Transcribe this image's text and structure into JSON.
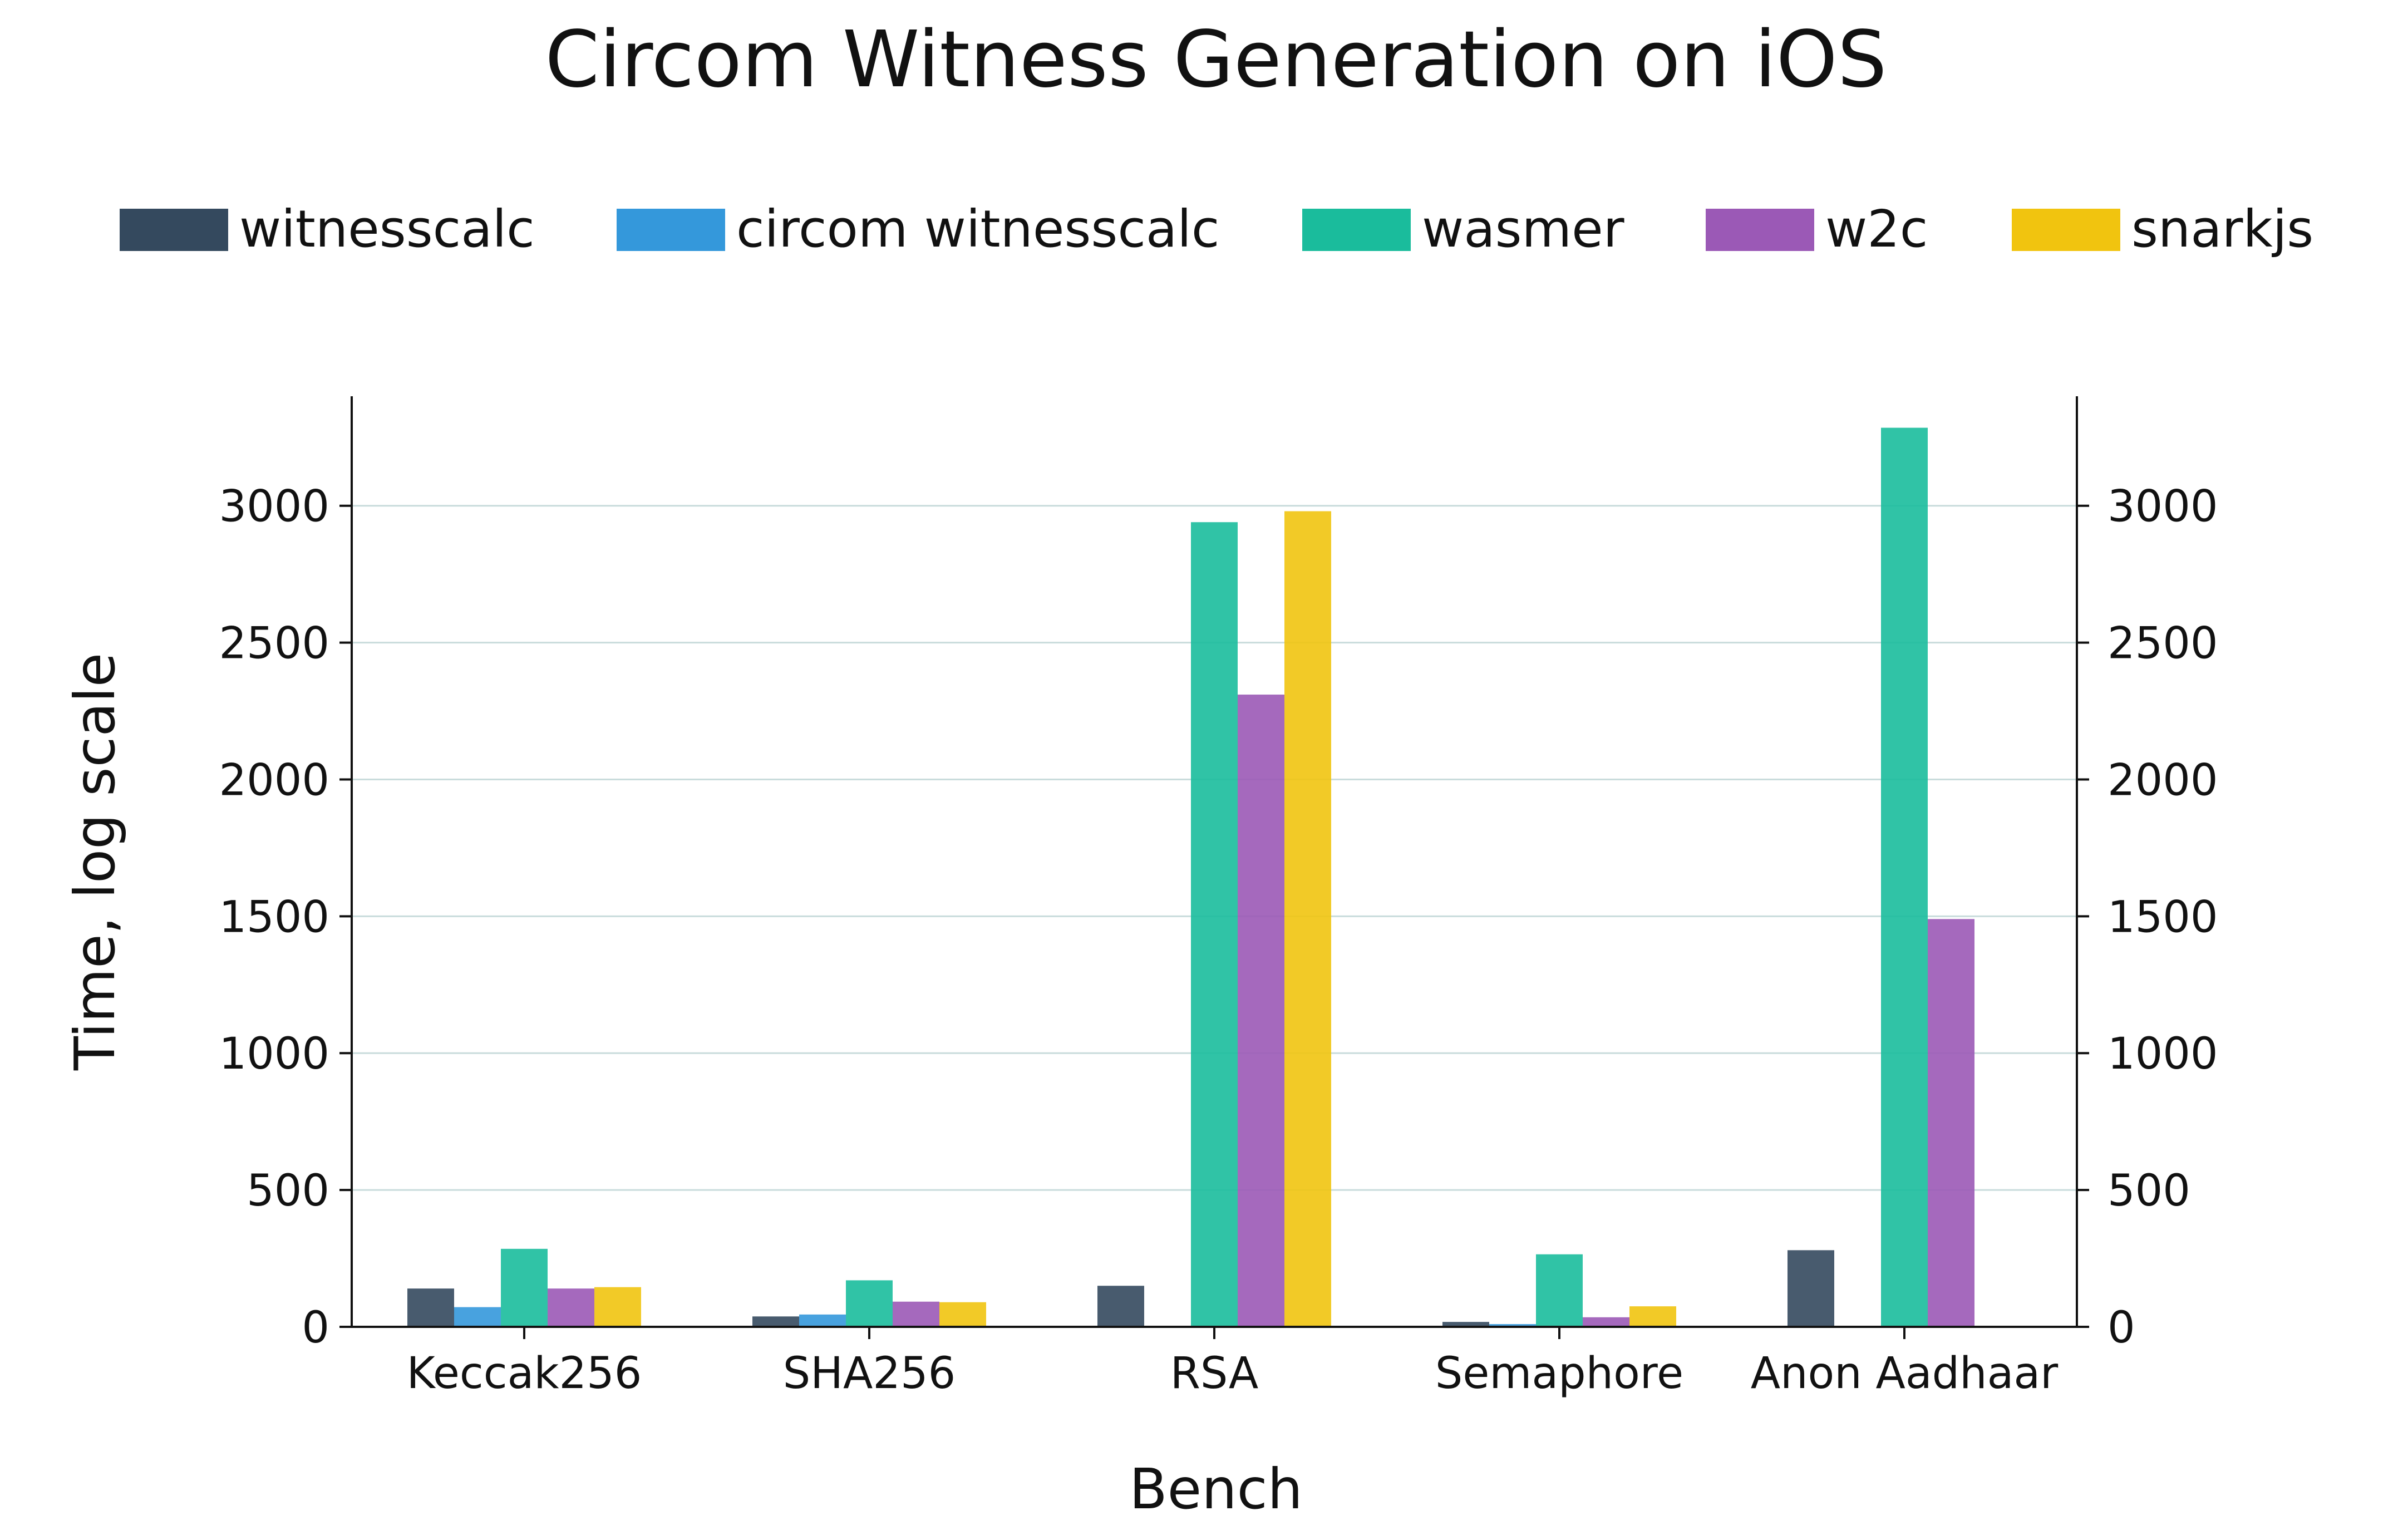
{
  "chart_data": {
    "type": "bar",
    "title": "Circom Witness Generation on iOS",
    "xlabel": "Bench",
    "ylabel": "Time, log scale",
    "categories": [
      "Keccak256",
      "SHA256",
      "RSA",
      "Semaphore",
      "Anon Aadhaar"
    ],
    "ylim": [
      0,
      3400
    ],
    "yticks": [
      0,
      500,
      1000,
      1500,
      2000,
      2500,
      3000
    ],
    "grid": true,
    "legend_position": "top",
    "series": [
      {
        "name": "witnesscalc",
        "color": "#34495e",
        "values": [
          140,
          38,
          150,
          18,
          280
        ]
      },
      {
        "name": "circom witnesscalc",
        "color": "#3498db",
        "values": [
          72,
          45,
          null,
          10,
          null
        ]
      },
      {
        "name": "wasmer",
        "color": "#1abc9c",
        "values": [
          285,
          170,
          2940,
          265,
          3285
        ]
      },
      {
        "name": "w2c",
        "color": "#9b59b6",
        "values": [
          140,
          92,
          2310,
          35,
          1490
        ]
      },
      {
        "name": "snarkjs",
        "color": "#f1c40f",
        "values": [
          145,
          90,
          2980,
          75,
          null
        ]
      }
    ]
  }
}
